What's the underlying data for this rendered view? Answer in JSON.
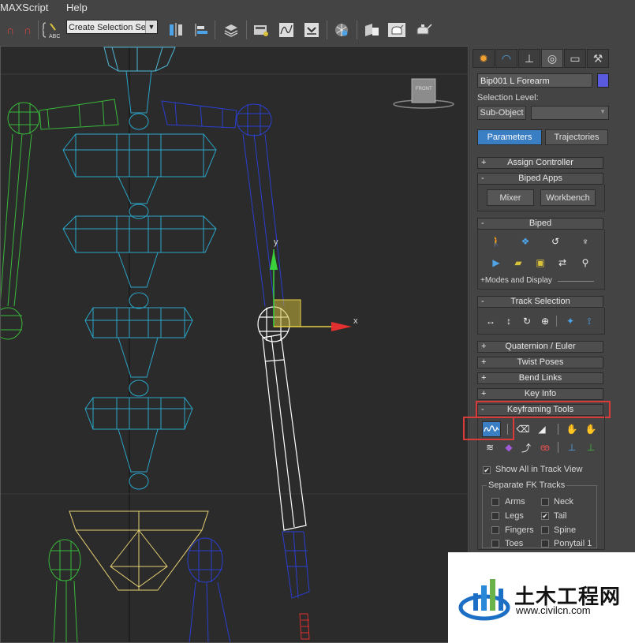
{
  "menubar": {
    "items": [
      "MAXScript",
      "Help"
    ]
  },
  "toolbar": {
    "selection_set_value": "Create Selection Se",
    "icons": [
      "magnet-icon",
      "abc-icon",
      "mirror-icon",
      "align-icon",
      "layers-icon",
      "curve-editor-icon",
      "schematic-icon",
      "material-editor-icon",
      "render-setup-icon",
      "render-frame-icon",
      "render-icon"
    ]
  },
  "viewport": {
    "axis_x": "x",
    "axis_y": "y",
    "viewcube_label": "FRONT"
  },
  "command_panel": {
    "tab_icons": [
      "create-icon",
      "modify-icon",
      "hierarchy-icon",
      "motion-icon",
      "display-icon",
      "utilities-icon"
    ],
    "object_name": "Bip001 L Forearm",
    "object_color": "#5a5ae0",
    "selection_level_label": "Selection Level:",
    "sub_object_label": "Sub-Object",
    "sub_object_value": "",
    "parameters_label": "Parameters",
    "trajectories_label": "Trajectories",
    "rollouts": {
      "assign_controller": {
        "sign": "+",
        "title": "Assign Controller"
      },
      "biped_apps": {
        "sign": "-",
        "title": "Biped Apps",
        "mixer": "Mixer",
        "workbench": "Workbench"
      },
      "biped": {
        "sign": "-",
        "title": "Biped",
        "modes_label": "+Modes and Display"
      },
      "track_selection": {
        "sign": "-",
        "title": "Track Selection"
      },
      "quaternion": {
        "sign": "+",
        "title": "Quaternion / Euler"
      },
      "twist_poses": {
        "sign": "+",
        "title": "Twist Poses"
      },
      "bend_links": {
        "sign": "+",
        "title": "Bend Links"
      },
      "key_info": {
        "sign": "+",
        "title": "Key Info"
      },
      "keyframing_tools": {
        "sign": "-",
        "title": "Keyframing Tools"
      }
    },
    "show_all_label": "Show All in Track View",
    "separate_fk_label": "Separate FK Tracks",
    "fk_tracks": [
      {
        "label": "Arms",
        "checked": false
      },
      {
        "label": "Neck",
        "checked": false
      },
      {
        "label": "Legs",
        "checked": false
      },
      {
        "label": "Tail",
        "checked": true
      },
      {
        "label": "Fingers",
        "checked": false
      },
      {
        "label": "Spine",
        "checked": false
      },
      {
        "label": "Toes",
        "checked": false
      },
      {
        "label": "Ponytail 1",
        "checked": false
      }
    ]
  },
  "watermark": {
    "brand": "土木工程网",
    "url": "www.civilcn.com"
  },
  "colors": {
    "highlight": "#d93b3b",
    "accent": "#3a7ec4"
  }
}
